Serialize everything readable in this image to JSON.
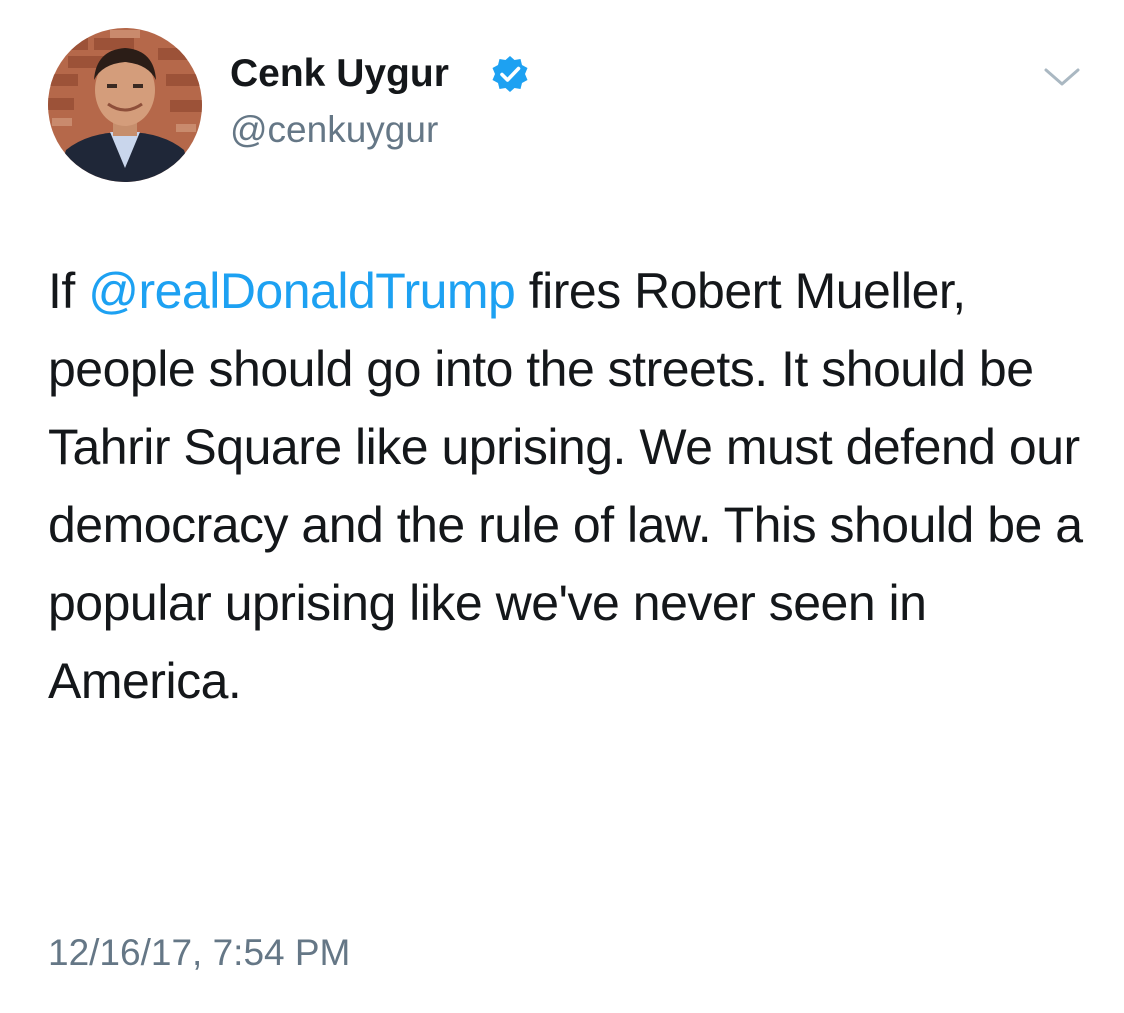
{
  "author": {
    "display_name": "Cenk Uygur",
    "handle": "@cenkuygur",
    "verified": true,
    "avatar_icon": "profile-photo"
  },
  "tweet": {
    "text_before": "If ",
    "mention": "@realDonaldTrump",
    "text_after": " fires Robert Mueller, people should go into the streets. It should be Tahrir Square like uprising. We must defend our democracy and the rule of law. This should be a popular uprising like we've never seen in America.",
    "timestamp": "12/16/17, 7:54 PM"
  },
  "icons": {
    "verified": "verified-badge-icon",
    "menu": "chevron-down-icon"
  },
  "colors": {
    "text": "#14171a",
    "secondary": "#657786",
    "link": "#1da1f2"
  }
}
